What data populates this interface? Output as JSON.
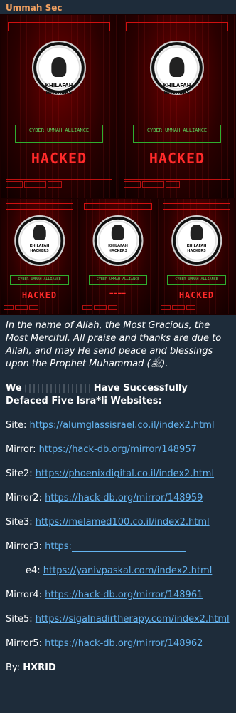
{
  "chat": {
    "sender_name": "Ummah Sec"
  },
  "image": {
    "alliance_text": "CYBER UMMAH ALLIANCE",
    "hacked_text": "HACKED",
    "seal_name": "KHILAFAH",
    "seal_sub": "HACKERS",
    "accent_red": "#ff2a2a",
    "accent_green": "#5cd65c"
  },
  "message": {
    "intro": "In the name of Allah, the Most Gracious, the Most Merciful. All praise and thanks are due to Allah, and may He send peace and blessings upon the Prophet Muhammad (ﷺ).",
    "heading_prefix": "We",
    "heading_suffix": "Have Successfully Defaced Five Isra*li Websites:",
    "rows": [
      {
        "label": "Site:",
        "link": "https://alumglassisrael.co.il/index2.html"
      },
      {
        "label": "Mirror:",
        "link": "https://hack-db.org/mirror/148957"
      },
      {
        "label": "Site2:",
        "link": "https://phoenixdigital.co.il/index2.html"
      },
      {
        "label": "Mirror2:",
        "link": "https://hack-db.org/mirror/148959"
      },
      {
        "label": "Site3:",
        "link": "https://melamed100.co.il/index2.html"
      },
      {
        "label": "Mirror3:",
        "link": "https:"
      },
      {
        "label": "e4:",
        "link": "https://yanivpaskal.com/index2.html"
      },
      {
        "label": "Mirror4:",
        "link": "https://hack-db.org/mirror/148961"
      },
      {
        "label": "Site5:",
        "link": "https://sigalnadirtherapy.com/index2.html"
      },
      {
        "label": "Mirror5:",
        "link": "https://hack-db.org/mirror/148962"
      }
    ],
    "by_label": "By:",
    "by_name": "HXRID"
  },
  "colors": {
    "bubble_bg": "#1e2c3a",
    "sender": "#f0a060",
    "link": "#64b4f0"
  }
}
